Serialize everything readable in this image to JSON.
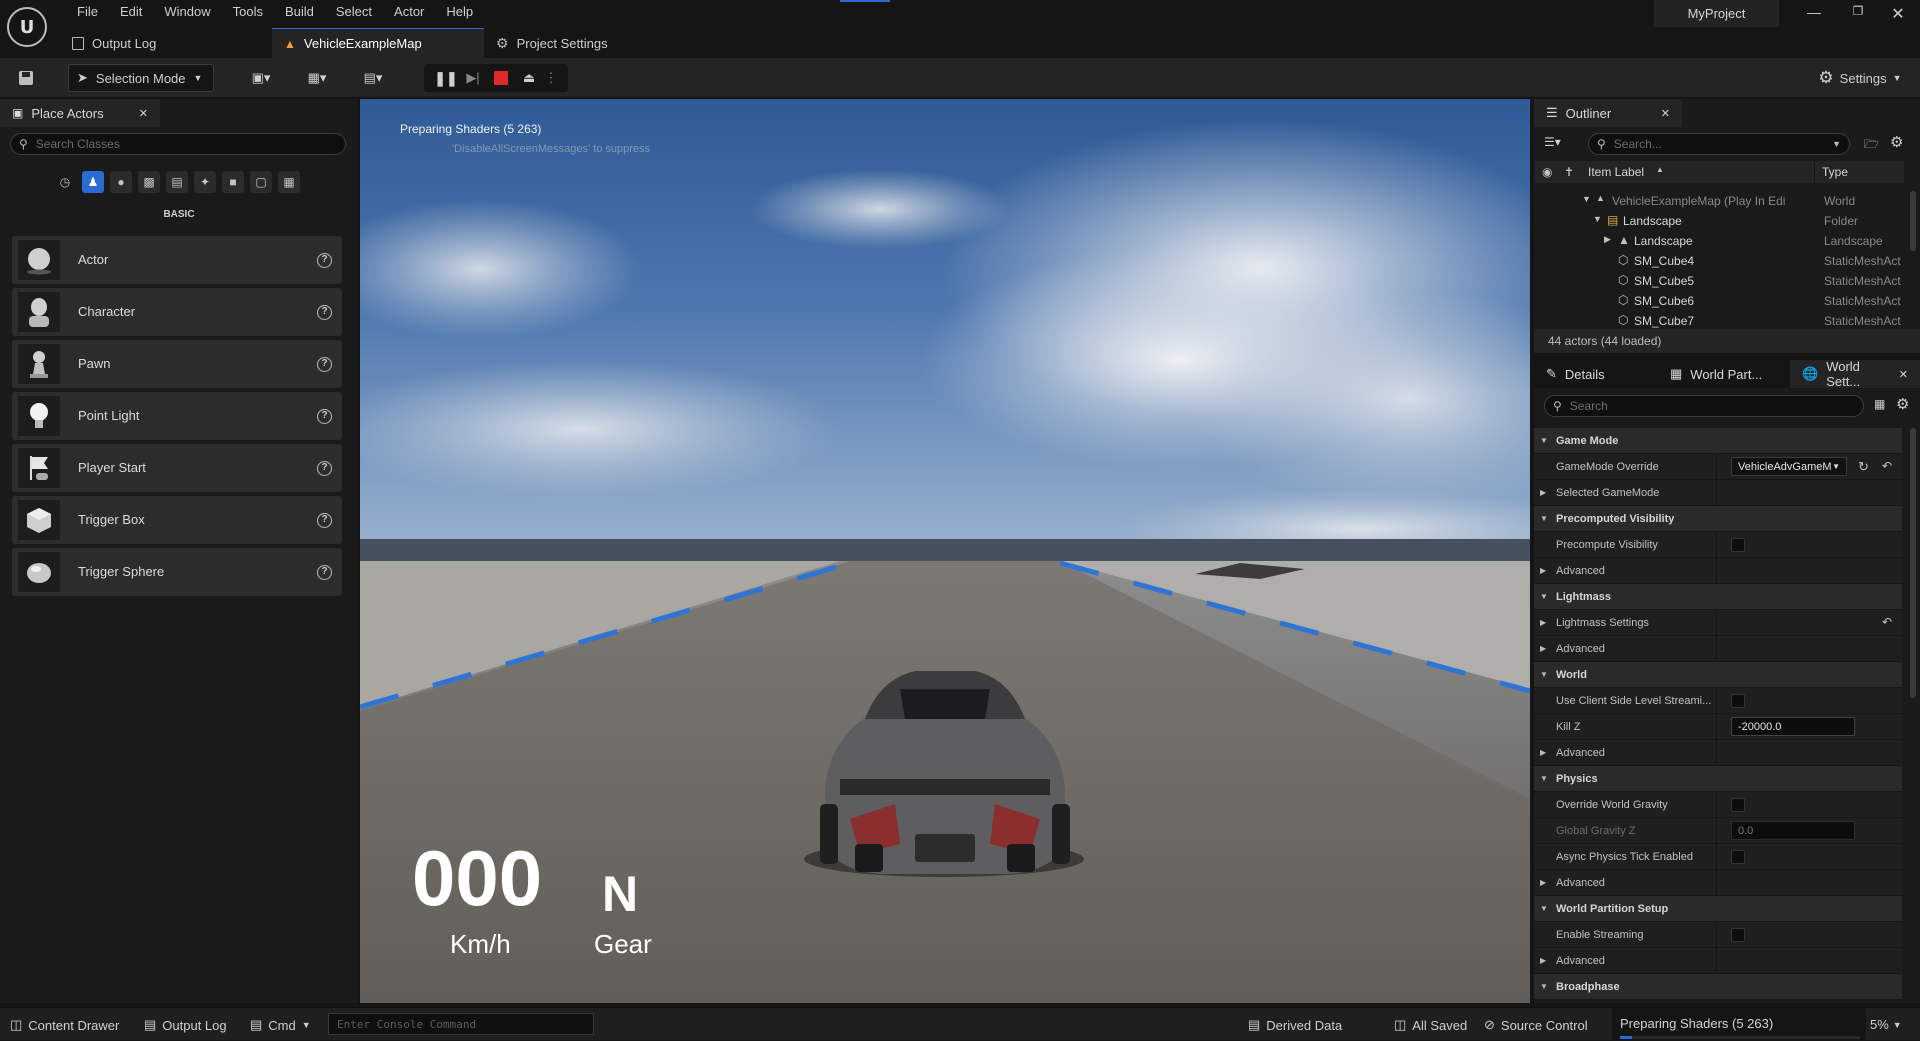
{
  "app": {
    "project": "MyProject",
    "menu": [
      "File",
      "Edit",
      "Window",
      "Tools",
      "Build",
      "Select",
      "Actor",
      "Help"
    ]
  },
  "tabs": [
    {
      "label": "Output Log",
      "icon": "output-log-icon"
    },
    {
      "label": "VehicleExampleMap",
      "icon": "level-icon",
      "active": true
    },
    {
      "label": "Project Settings",
      "icon": "settings-icon"
    }
  ],
  "toolbar": {
    "mode": "Selection Mode",
    "settings": "Settings"
  },
  "place_actors": {
    "title": "Place Actors",
    "search_placeholder": "Search Classes",
    "category": "BASIC",
    "items": [
      "Actor",
      "Character",
      "Pawn",
      "Point Light",
      "Player Start",
      "Trigger Box",
      "Trigger Sphere"
    ]
  },
  "viewport": {
    "shader_message": "Preparing Shaders (5   263)",
    "hint_message": "'DisableAllScreenMessages' to suppress",
    "speed": "000",
    "speed_unit": "Km/h",
    "gear": "N",
    "gear_label": "Gear"
  },
  "outliner": {
    "title": "Outliner",
    "search_placeholder": "Search...",
    "col_label": "Item Label",
    "col_type": "Type",
    "rows": [
      {
        "label": "VehicleExampleMap (Play In Edi",
        "type": "World",
        "indent": 0,
        "dim": true
      },
      {
        "label": "Landscape",
        "type": "Folder",
        "indent": 1
      },
      {
        "label": "Landscape",
        "type": "Landscape",
        "indent": 2
      },
      {
        "label": "SM_Cube4",
        "type": "StaticMeshAct",
        "indent": 2
      },
      {
        "label": "SM_Cube5",
        "type": "StaticMeshAct",
        "indent": 2
      },
      {
        "label": "SM_Cube6",
        "type": "StaticMeshAct",
        "indent": 2
      },
      {
        "label": "SM_Cube7",
        "type": "StaticMeshAct",
        "indent": 2
      }
    ],
    "footer": "44 actors (44 loaded)"
  },
  "details": {
    "tabs": [
      "Details",
      "World Part...",
      "World Sett..."
    ],
    "search_placeholder": "Search",
    "rows": [
      {
        "kind": "sec",
        "name": "Game Mode"
      },
      {
        "kind": "prop",
        "name": "GameMode Override",
        "dropdown": "VehicleAdvGameM"
      },
      {
        "kind": "sub",
        "name": "Selected GameMode"
      },
      {
        "kind": "sec",
        "name": "Precomputed Visibility"
      },
      {
        "kind": "prop",
        "name": "Precompute Visibility",
        "check": true
      },
      {
        "kind": "sub",
        "name": "Advanced"
      },
      {
        "kind": "sec",
        "name": "Lightmass"
      },
      {
        "kind": "sub",
        "name": "Lightmass Settings",
        "reset": true
      },
      {
        "kind": "sub",
        "name": "Advanced"
      },
      {
        "kind": "sec",
        "name": "World"
      },
      {
        "kind": "prop",
        "name": "Use Client Side Level Streami...",
        "check": true
      },
      {
        "kind": "prop",
        "name": "Kill Z",
        "value": "-20000.0"
      },
      {
        "kind": "sub",
        "name": "Advanced"
      },
      {
        "kind": "sec",
        "name": "Physics"
      },
      {
        "kind": "prop",
        "name": "Override World Gravity",
        "check": true
      },
      {
        "kind": "prop",
        "name": "Global Gravity Z",
        "value": "0.0",
        "dim": true
      },
      {
        "kind": "prop",
        "name": "Async Physics Tick Enabled",
        "check": true
      },
      {
        "kind": "sub",
        "name": "Advanced"
      },
      {
        "kind": "sec",
        "name": "World Partition Setup"
      },
      {
        "kind": "prop",
        "name": "Enable Streaming",
        "check": true
      },
      {
        "kind": "sub",
        "name": "Advanced"
      },
      {
        "kind": "sec",
        "name": "Broadphase"
      }
    ]
  },
  "statusbar": {
    "content_drawer": "Content Drawer",
    "output_log": "Output Log",
    "cmd": "Cmd",
    "console_placeholder": "Enter Console Command",
    "derived_data": "Derived Data",
    "all_saved": "All Saved",
    "source_control": "Source Control",
    "shaders": "Preparing Shaders (5 263)",
    "progress_percent": 5,
    "progress_label": "5%"
  },
  "colors": {
    "accent": "#2b6ad1",
    "sky": "#3d6aa6",
    "road": "#6b6865",
    "stripe": "#2f74d4"
  }
}
